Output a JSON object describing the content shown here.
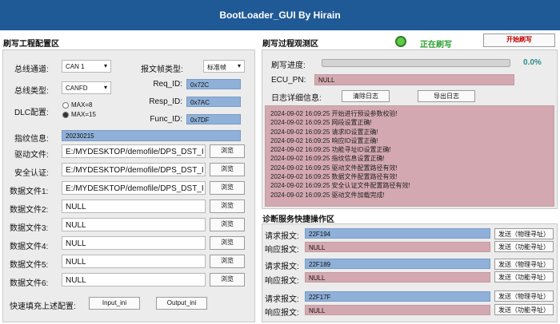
{
  "window": {
    "title": "BootLoader_GUI By Hirain"
  },
  "config": {
    "section_title": "刷写工程配置区",
    "bus_channel_label": "总线通道:",
    "bus_channel_value": "CAN 1",
    "frame_type_label": "报文帧类型:",
    "frame_type_value": "标准帧",
    "bus_type_label": "总线类型:",
    "bus_type_value": "CANFD",
    "req_id_label": "Req_ID:",
    "req_id_value": "0x72C",
    "resp_id_label": "Resp_ID:",
    "resp_id_value": "0x7AC",
    "func_id_label": "Func_ID:",
    "func_id_value": "0x7DF",
    "dlc_label": "DLC配置:",
    "dlc_options": [
      {
        "label": "MAX=8",
        "selected": false
      },
      {
        "label": "MAX=15",
        "selected": true
      }
    ],
    "fingerprint_label": "指纹信息:",
    "fingerprint_value": "20230215",
    "files": [
      {
        "label": "驱动文件:",
        "value": "E:/MYDESKTOP/demofile/DPS_DST_I",
        "button": "浏览"
      },
      {
        "label": "安全认证:",
        "value": "E:/MYDESKTOP/demofile/DPS_DST_I",
        "button": "浏览"
      },
      {
        "label": "数据文件1:",
        "value": "E:/MYDESKTOP/demofile/DPS_DST_I",
        "button": "浏览"
      },
      {
        "label": "数据文件2:",
        "value": "NULL",
        "button": "浏览"
      },
      {
        "label": "数据文件3:",
        "value": "NULL",
        "button": "浏览"
      },
      {
        "label": "数据文件4:",
        "value": "NULL",
        "button": "浏览"
      },
      {
        "label": "数据文件5:",
        "value": "NULL",
        "button": "浏览"
      },
      {
        "label": "数据文件6:",
        "value": "NULL",
        "button": "浏览"
      }
    ],
    "quick_fill_label": "快速填充上述配置:",
    "input_ini": "Input_ini",
    "output_ini": "Output_ini"
  },
  "observe": {
    "section_title": "刷写过程观测区",
    "status_text": "正在刷写",
    "status_color": "#2e9e2e",
    "start_button": "开始刷写",
    "progress_label": "刷写进度:",
    "progress_value": 0.0,
    "progress_text": "0.0%",
    "ecu_pn_label": "ECU_PN:",
    "ecu_pn_value": "NULL",
    "log_label": "日志详细信息:",
    "clear_log": "清除日志",
    "export_log": "导出日志",
    "log_lines": [
      "2024-09-02 16:09:25 开始进行预设参数校验!",
      "",
      "2024-09-02 16:09:25 网段设置正确!",
      "2024-09-02 16:09:25 请求ID设置正确!",
      "2024-09-02 16:09:25 响应ID设置正确!",
      "2024-09-02 16:09:25 功能寻址ID设置正确!",
      "2024-09-02 16:09:25 指纹信息设置正确!",
      "2024-09-02 16:09:25 驱动文件配置路径有效!",
      "2024-09-02 16:09:25 数据文件配置路径有效!",
      "2024-09-02 16:09:25 安全认证文件配置路径有效!",
      "2024-09-02 16:09:25 驱动文件加载完成!"
    ]
  },
  "diag": {
    "section_title": "诊断服务快捷操作区",
    "groups": [
      {
        "req_label": "请求报文:",
        "req_value": "22F194",
        "resp_label": "响应报文:",
        "resp_value": "NULL",
        "send_phys": "发送（物理寻址）",
        "send_func": "发送（功能寻址）"
      },
      {
        "req_label": "请求报文:",
        "req_value": "22F189",
        "resp_label": "响应报文:",
        "resp_value": "NULL",
        "send_phys": "发送（物理寻址）",
        "send_func": "发送（功能寻址）"
      },
      {
        "req_label": "请求报文:",
        "req_value": "22F17F",
        "resp_label": "响应报文:",
        "resp_value": "NULL",
        "send_phys": "发送（物理寻址）",
        "send_func": "发送（功能寻址）"
      }
    ]
  }
}
